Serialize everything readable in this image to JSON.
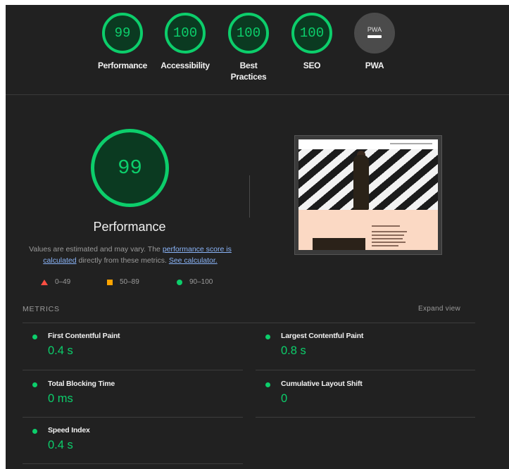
{
  "categories": [
    {
      "label": "Performance",
      "score": "99"
    },
    {
      "label": "Accessibility",
      "score": "100"
    },
    {
      "label": "Best Practices",
      "score": "100"
    },
    {
      "label": "SEO",
      "score": "100"
    },
    {
      "label": "PWA",
      "badge": "PWA"
    }
  ],
  "main": {
    "score": "99",
    "title": "Performance",
    "desc_prefix": "Values are estimated and may vary. The ",
    "desc_link1": "performance score is calculated",
    "desc_middle": " directly from these metrics. ",
    "desc_link2": "See calculator."
  },
  "legend": {
    "fail": "0–49",
    "average": "50–89",
    "pass": "90–100"
  },
  "colors": {
    "pass": "#0cce6b",
    "average": "#ffa400",
    "fail": "#ff4e42",
    "background": "#212121"
  },
  "metrics": {
    "title": "METRICS",
    "expand_label": "Expand view",
    "items": [
      {
        "name": "First Contentful Paint",
        "value": "0.4 s"
      },
      {
        "name": "Largest Contentful Paint",
        "value": "0.8 s"
      },
      {
        "name": "Total Blocking Time",
        "value": "0 ms"
      },
      {
        "name": "Cumulative Layout Shift",
        "value": "0"
      },
      {
        "name": "Speed Index",
        "value": "0.4 s"
      }
    ]
  }
}
